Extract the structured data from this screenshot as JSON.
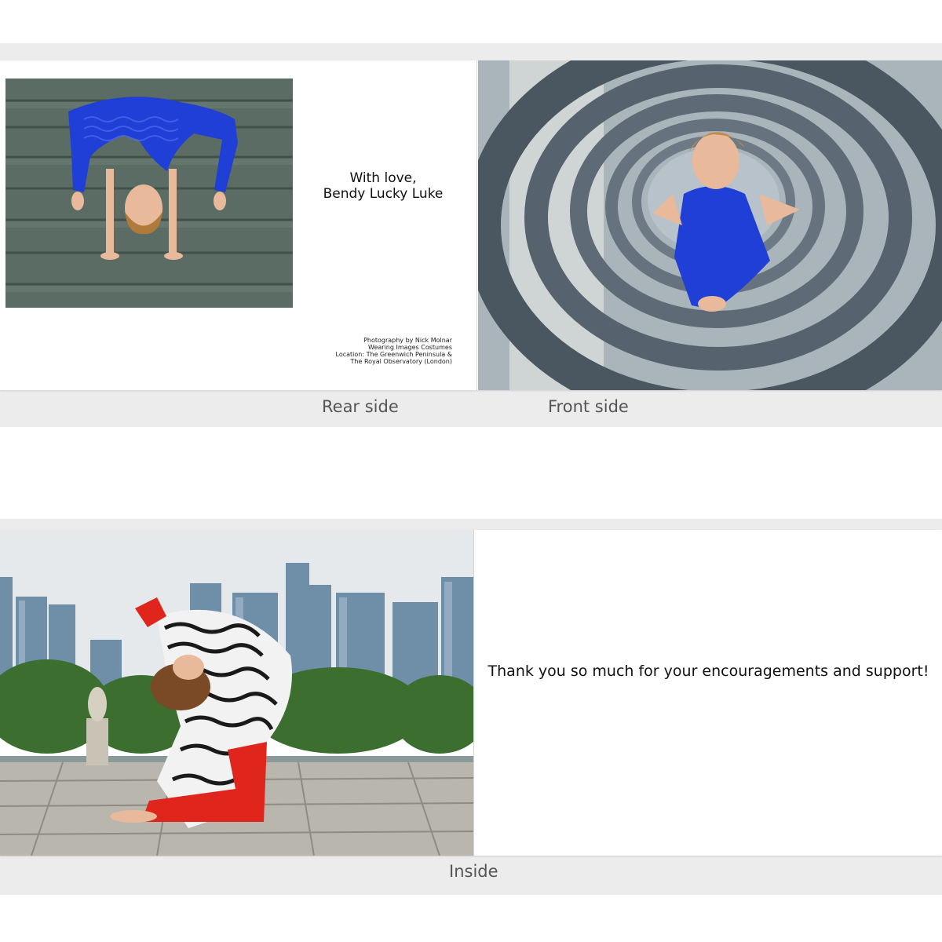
{
  "rear": {
    "message_lines": [
      "With love,",
      "Bendy Lucky Luke"
    ],
    "credit_lines": [
      "Photography by Nick Molnar",
      "Wearing Images Costumes",
      "Location: The Greenwich Peninsula &",
      "The Royal Observatory (London)"
    ],
    "label": "Rear side"
  },
  "front": {
    "label": "Front side"
  },
  "inside": {
    "message": "Thank you so much for your encouragements and support!",
    "label": "Inside"
  },
  "colors": {
    "band": "#ececec",
    "leotard_blue": "#1f3fd6",
    "stone": "#5d7066",
    "spiral": "#4f5b66",
    "costume_red": "#e0261c"
  }
}
